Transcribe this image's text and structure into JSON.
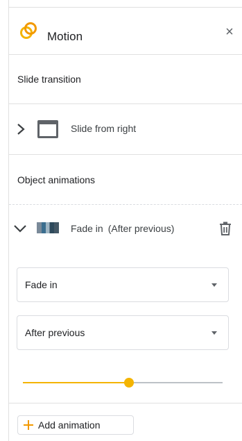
{
  "panel": {
    "title": "Motion",
    "close_glyph": "×",
    "icon": "motion-rings-icon",
    "accent_color": "#f4b400"
  },
  "slide_transition": {
    "section_label": "Slide transition",
    "selected_label": "Slide from right",
    "icon": "slide-thumbnail-icon",
    "expanded": false
  },
  "object_animations": {
    "section_label": "Object animations",
    "items": [
      {
        "effect": "Fade in",
        "timing": "(After previous)",
        "expanded": true
      }
    ],
    "effect_select": {
      "value": "Fade in"
    },
    "start_select": {
      "value": "After previous"
    },
    "duration_slider": {
      "fraction": 0.53
    },
    "add_button_label": "Add animation"
  }
}
